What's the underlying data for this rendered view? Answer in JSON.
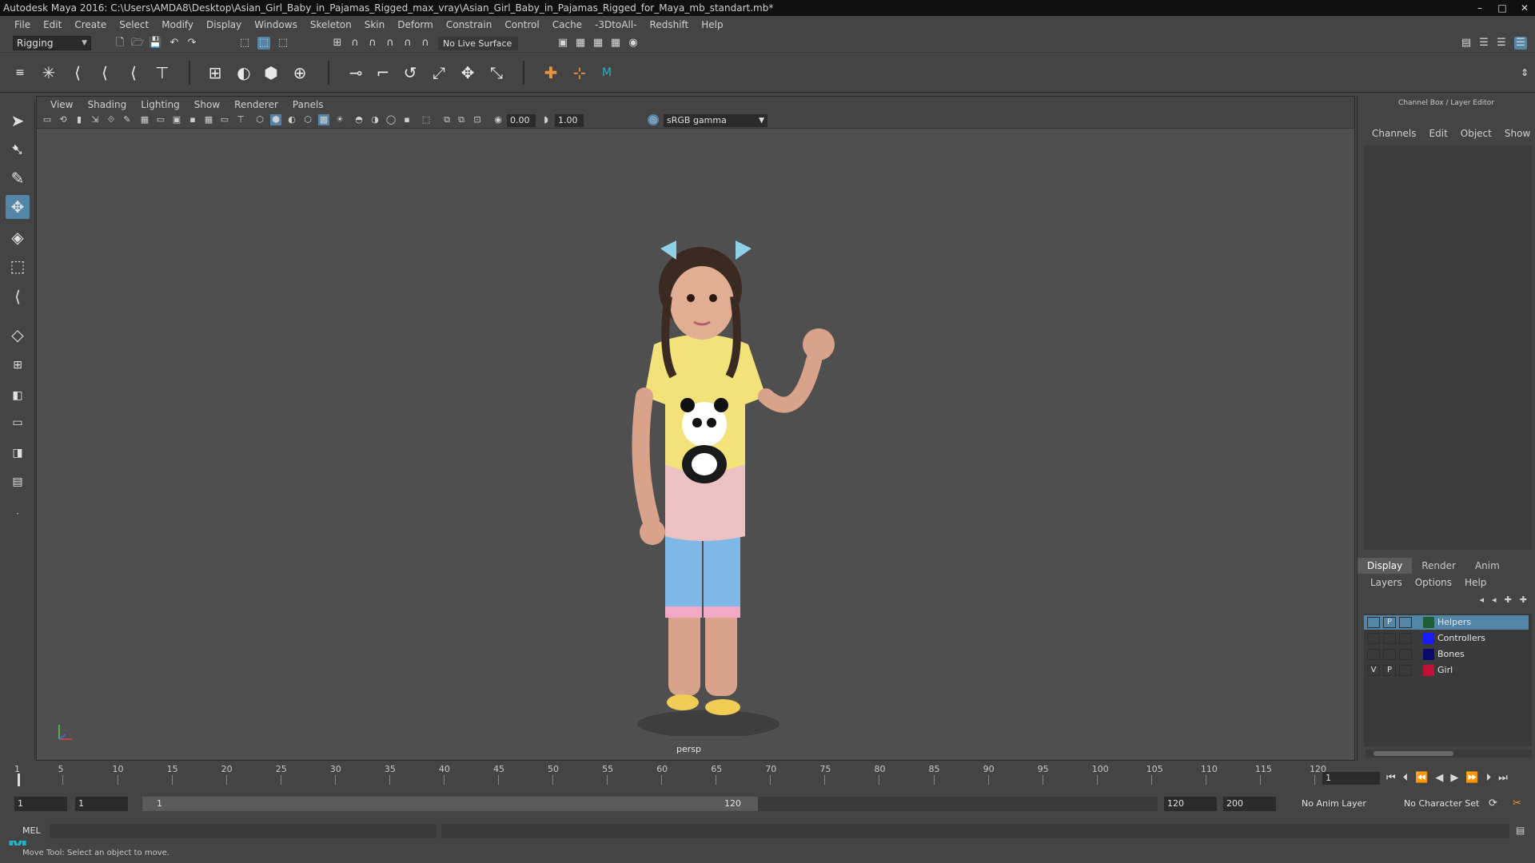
{
  "window": {
    "title": "Autodesk Maya 2016: C:\\Users\\AMDA8\\Desktop\\Asian_Girl_Baby_in_Pajamas_Rigged_max_vray\\Asian_Girl_Baby_in_Pajamas_Rigged_for_Maya_mb_standart.mb*",
    "minimize": "–",
    "maximize": "□",
    "close": "✕"
  },
  "menubar": [
    "File",
    "Edit",
    "Create",
    "Select",
    "Modify",
    "Display",
    "Windows",
    "Skeleton",
    "Skin",
    "Deform",
    "Constrain",
    "Control",
    "Cache",
    "-3DtoAll-",
    "Redshift",
    "Help"
  ],
  "statusline": {
    "menuset": "Rigging",
    "live_surface": "No Live Surface"
  },
  "viewport": {
    "menu": [
      "View",
      "Shading",
      "Lighting",
      "Show",
      "Renderer",
      "Panels"
    ],
    "exposure": "0.00",
    "gamma": "1.00",
    "color_space": "sRGB gamma",
    "camera": "persp"
  },
  "channelbox": {
    "title": "Channel Box / Layer Editor",
    "tabs": [
      "Channels",
      "Edit",
      "Object",
      "Show"
    ]
  },
  "layer_editor": {
    "tabs": [
      "Display",
      "Render",
      "Anim"
    ],
    "menu": [
      "Layers",
      "Options",
      "Help"
    ],
    "layers": [
      {
        "v": "",
        "p": "P",
        "name": "Helpers",
        "color": "#1e5e30",
        "selected": true
      },
      {
        "v": "",
        "p": "",
        "name": "Controllers",
        "color": "#1a1aff",
        "selected": false
      },
      {
        "v": "",
        "p": "",
        "name": "Bones",
        "color": "#0a0a6a",
        "selected": false
      },
      {
        "v": "V",
        "p": "P",
        "name": "Girl",
        "color": "#c0103a",
        "selected": false
      }
    ]
  },
  "timeslider": {
    "ticks": [
      "1",
      "5",
      "10",
      "15",
      "20",
      "25",
      "30",
      "35",
      "40",
      "45",
      "50",
      "55",
      "60",
      "65",
      "70",
      "75",
      "80",
      "85",
      "90",
      "95",
      "100",
      "105",
      "110",
      "115",
      "120"
    ],
    "current_frame": "1"
  },
  "range": {
    "start": "1",
    "current": "1",
    "slider_start": "1",
    "slider_end": "120",
    "end": "120",
    "anim_end": "200",
    "anim_layer": "No Anim Layer",
    "character_set": "No Character Set"
  },
  "cmdline": {
    "label": "MEL"
  },
  "helpline": {
    "text": "Move Tool: Select an object to move."
  },
  "colors": {
    "accent": "#5285a6",
    "maya_logo": "#1fb5c8"
  }
}
